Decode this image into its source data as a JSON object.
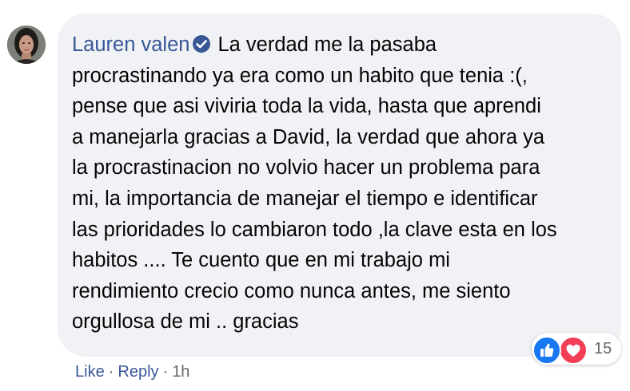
{
  "comment": {
    "author": "Lauren valen",
    "verified_icon": "check-circle",
    "lines": [
      "La verdad me la pasaba",
      "procrastinando ya era como un habito que tenia :(,",
      "pense que asi viviria toda la vida, hasta que aprendi",
      "a manejarla gracias a David, la verdad que ahora ya",
      "la procrastinacion no volvio hacer un problema para",
      "mi, la importancia de manejar el tiempo e identificar",
      "las prioridades lo cambiaron todo ,la clave esta en los",
      "habitos .... Te cuento que en mi trabajo mi",
      "rendimiento crecio como nunca antes, me siento",
      "orgullosa de mi .. gracias"
    ]
  },
  "reactions": {
    "icons": [
      "like-icon",
      "love-icon"
    ],
    "count": "15"
  },
  "actions": {
    "like_label": "Like",
    "reply_label": "Reply",
    "separator": "·",
    "timestamp": "1h"
  },
  "colors": {
    "link": "#385898",
    "bubble": "#f0f2f5",
    "text": "#050505",
    "meta": "#65676b",
    "like": "#1877f2",
    "love": "#f33e58"
  }
}
